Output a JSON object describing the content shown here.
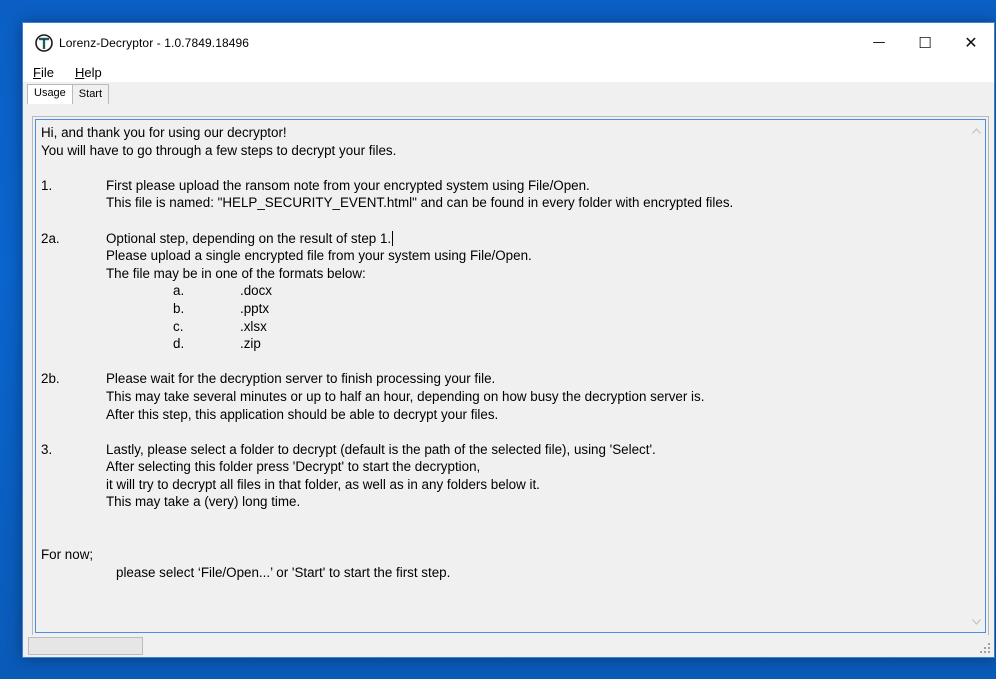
{
  "window": {
    "title": "Lorenz-Decryptor - 1.0.7849.18496",
    "minimize_glyph": "—",
    "maximize_glyph": "☐",
    "close_glyph": "✕"
  },
  "menu": {
    "file": {
      "accel": "F",
      "rest": "ile"
    },
    "help": {
      "accel": "H",
      "rest": "elp"
    }
  },
  "tabs": [
    {
      "label": "Usage",
      "active": true
    },
    {
      "label": "Start",
      "active": false
    }
  ],
  "content": {
    "intro_1": "Hi, and thank you for using our decryptor!",
    "intro_2": "You will have to go through a few steps to decrypt your files.",
    "step1_num": "1.",
    "step1_line1": "First please upload the ransom note from your encrypted system using File/Open.",
    "step1_line2": "This file is named: \"HELP_SECURITY_EVENT.html\" and can be found in every folder with encrypted files.",
    "step2a_num": "2a.",
    "step2a_line1": "Optional step, depending on the result of step 1.",
    "step2a_line2": "Please upload a single encrypted file from your system using File/Open.",
    "step2a_line3": "The file may be in one of the formats below:",
    "formats": [
      {
        "letter": "a.",
        "ext": ".docx"
      },
      {
        "letter": "b.",
        "ext": ".pptx"
      },
      {
        "letter": "c.",
        "ext": ".xlsx"
      },
      {
        "letter": "d.",
        "ext": ".zip"
      }
    ],
    "step2b_num": "2b.",
    "step2b_line1": "Please wait for the decryption server to finish processing your file.",
    "step2b_line2": "This may take several minutes or up to half an hour, depending on how busy the decryption server is.",
    "step2b_line3": "After this step, this application should be able to decrypt your files.",
    "step3_num": "3.",
    "step3_line1": "Lastly, please select a folder to decrypt (default is the path of the selected file), using 'Select'.",
    "step3_line2": "After selecting this folder press 'Decrypt' to start the decryption,",
    "step3_line3": "it will try to decrypt all files in that folder, as well as in any folders below it.",
    "step3_line4": "This may take a (very) long time.",
    "fornow_1": "For now;",
    "fornow_2": "please select ‘File/Open...’ or 'Start' to start the first step."
  },
  "colors": {
    "desktop": "#0a64cc",
    "window_bg": "#f0f0f0",
    "textbox_border": "#4a90e2"
  }
}
